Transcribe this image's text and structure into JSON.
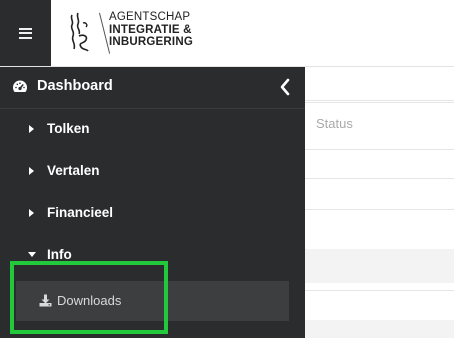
{
  "header": {
    "menu_icon": "hamburger-icon",
    "logo": {
      "line1": "AGENTSCHAP",
      "line2": "INTEGRATIE &",
      "line3": "INBURGERING"
    }
  },
  "background": {
    "status_label": "Status"
  },
  "sidebar": {
    "dashboard": {
      "label": "Dashboard",
      "icon": "dashboard-gauge-icon",
      "collapse_icon": "chevron-left-icon"
    },
    "items": [
      {
        "label": "Tolken",
        "icon": "caret-right-icon",
        "expanded": false
      },
      {
        "label": "Vertalen",
        "icon": "caret-right-icon",
        "expanded": false
      },
      {
        "label": "Financieel",
        "icon": "caret-right-icon",
        "expanded": false
      },
      {
        "label": "Info",
        "icon": "caret-down-icon",
        "expanded": true
      }
    ],
    "info_children": [
      {
        "label": "Downloads",
        "icon": "download-icon"
      }
    ]
  },
  "colors": {
    "sidebar_bg": "#2b2c2e",
    "selected_item_bg": "#3d3e40",
    "highlight": "#22c93a"
  }
}
